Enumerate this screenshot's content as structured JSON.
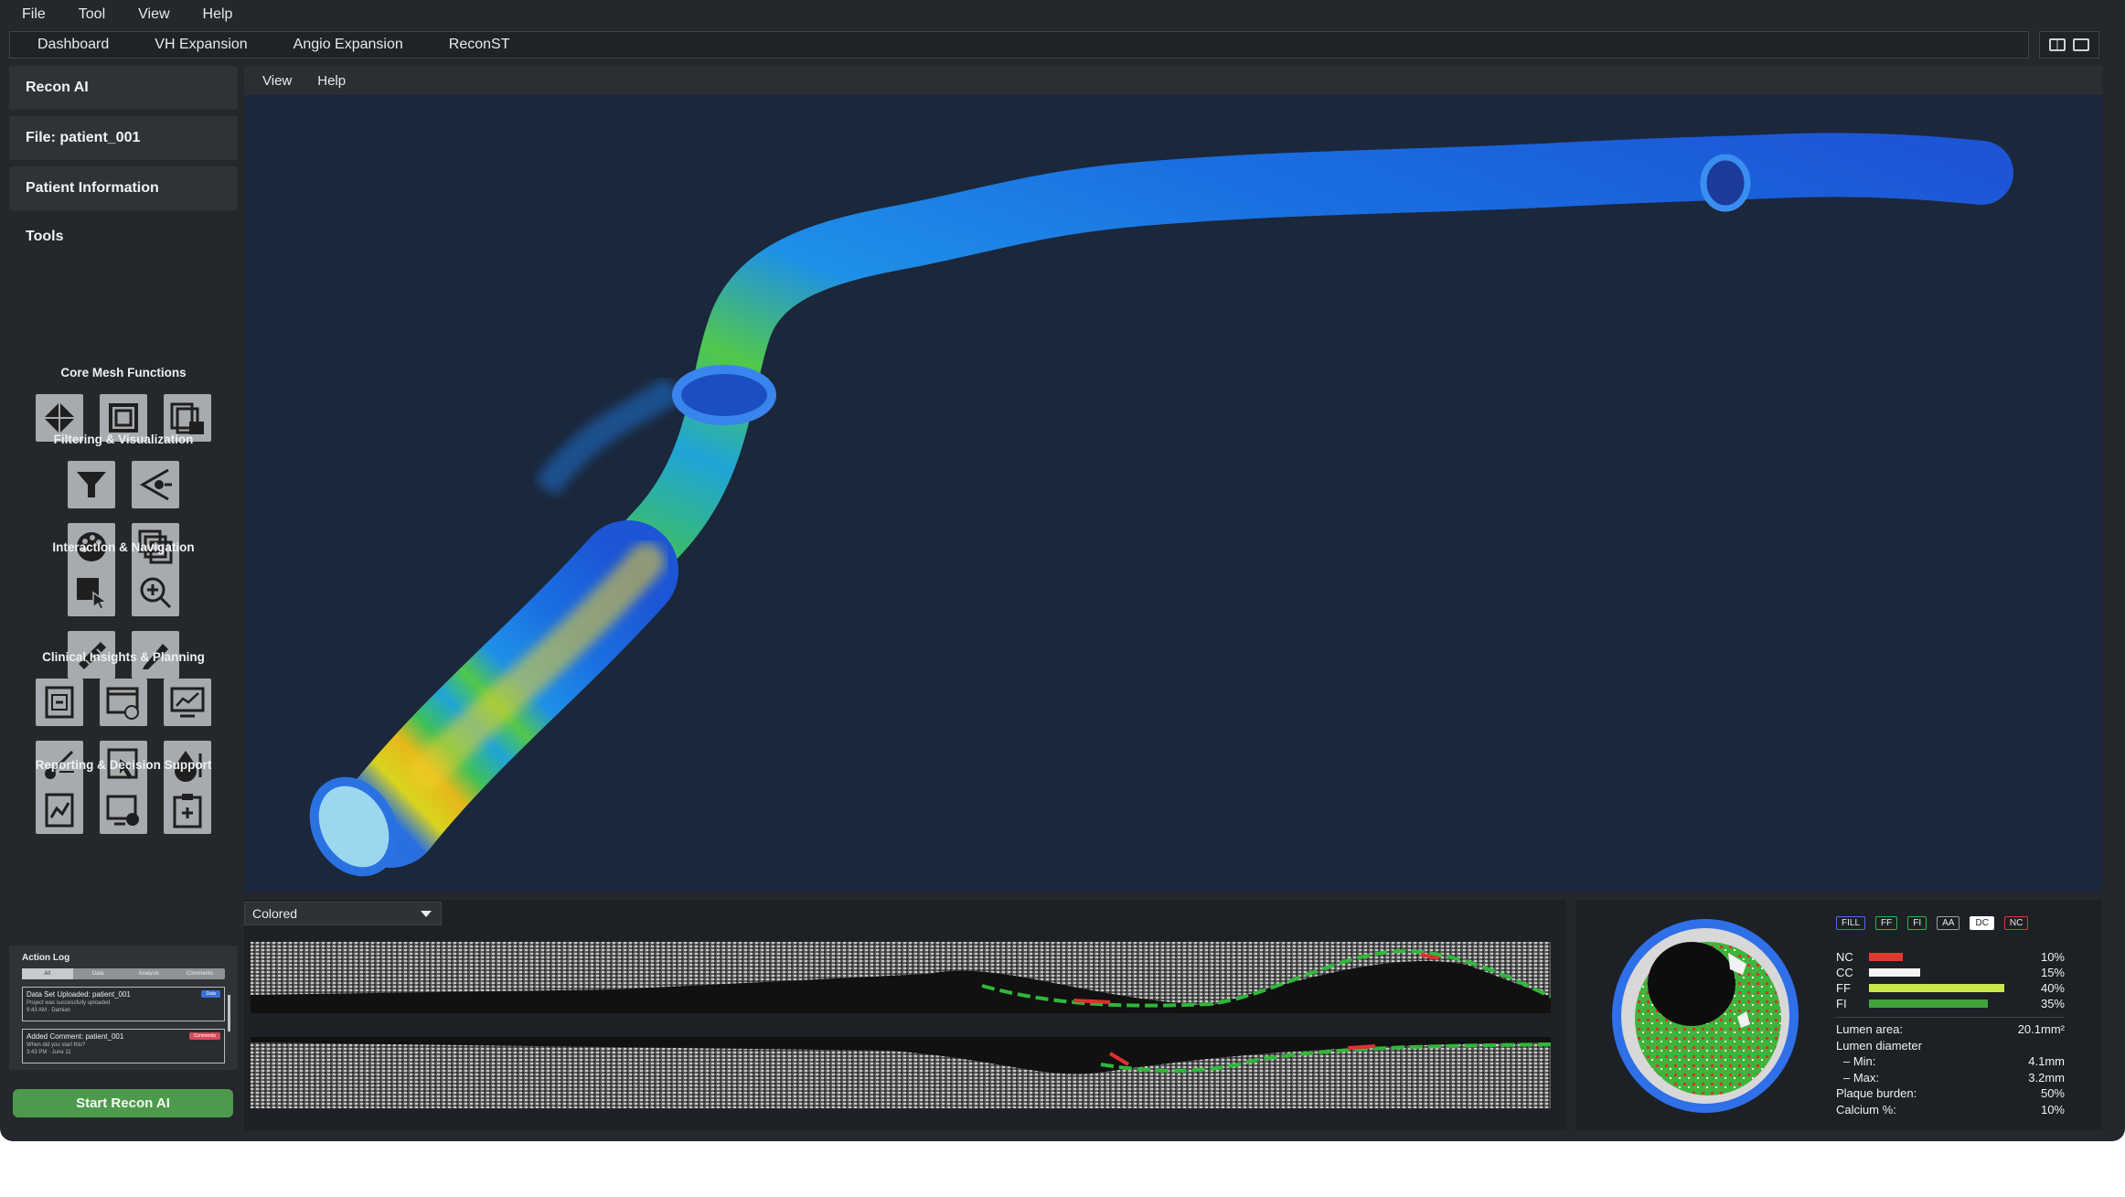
{
  "menubar": {
    "items": [
      "File",
      "Tool",
      "View",
      "Help"
    ]
  },
  "tabs": [
    "Dashboard",
    "VH Expansion",
    "Angio Expansion",
    "ReconST"
  ],
  "sidebar": {
    "cards": [
      "Recon AI",
      "File: patient_001",
      "Patient Information"
    ],
    "tools_title": "Tools",
    "sections": [
      {
        "title": "Core Mesh Functions",
        "icons": [
          "mesh-octahedron-icon",
          "frame-layers-icon",
          "save-copy-icon"
        ]
      },
      {
        "title": "Filtering & Visualization",
        "icons": [
          "filter-funnel-icon",
          "slice-view-icon",
          "color-palette-icon",
          "layers-copy-icon"
        ]
      },
      {
        "title": "Interaction & Navigation",
        "icons": [
          "select-cursor-icon",
          "zoom-in-icon",
          "ruler-icon",
          "pencil-icon"
        ]
      },
      {
        "title": "Clinical Insights & Planning",
        "icons": [
          "scan-document-icon",
          "timeline-window-icon",
          "monitor-chart-icon",
          "stent-tool-icon",
          "touch-select-icon",
          "blood-drop-icon"
        ]
      },
      {
        "title": "Reporting & Decision Support",
        "icons": [
          "report-chart-icon",
          "screen-settings-icon",
          "clipboard-medical-icon"
        ]
      }
    ],
    "action_log": {
      "title": "Action Log",
      "tabs": [
        "All",
        "Data",
        "Analysis",
        "Comments"
      ],
      "items": [
        {
          "title": "Data Set Uploaded: patient_001",
          "desc": "Project was successfully uploaded",
          "meta": "9:43 AM · Damian",
          "badge": "Data",
          "badge_color": "#3b6fd6"
        },
        {
          "title": "Added Comment: patient_001",
          "desc": "When did you start this?",
          "meta": "3:43 PM · June 11",
          "badge": "Comments",
          "badge_color": "#d64a5b"
        }
      ]
    },
    "start_button": "Start Recon AI"
  },
  "viewport": {
    "menu": [
      "View",
      "Help"
    ]
  },
  "ivus": {
    "mode": "Colored"
  },
  "cross_section": {
    "legend_buttons": [
      {
        "label": "FILL",
        "color": "#4a6fd8"
      },
      {
        "label": "FF",
        "color": "#2fb34a"
      },
      {
        "label": "FI",
        "color": "#2fb34a"
      },
      {
        "label": "AA",
        "color": "#9aa0a6"
      },
      {
        "label": "DC",
        "color": "#ffffff"
      },
      {
        "label": "NC",
        "color": "#d83a3a"
      }
    ],
    "composition": [
      {
        "name": "NC",
        "value": 10,
        "label": "10%",
        "color": "#e03a30"
      },
      {
        "name": "CC",
        "value": 15,
        "label": "15%",
        "color": "#f4f4f4"
      },
      {
        "name": "FF",
        "value": 40,
        "label": "40%",
        "color": "#c8e84a"
      },
      {
        "name": "FI",
        "value": 35,
        "label": "35%",
        "color": "#3fa53a"
      }
    ],
    "metrics": [
      {
        "label": "Lumen area:",
        "value": "20.1mm²",
        "sub": false
      },
      {
        "label": "Lumen diameter",
        "value": "",
        "sub": false
      },
      {
        "label": "–  Min:",
        "value": "4.1mm",
        "sub": true
      },
      {
        "label": "–  Max:",
        "value": "3.2mm",
        "sub": true
      },
      {
        "label": "Plaque burden:",
        "value": "50%",
        "sub": false
      },
      {
        "label": "Calcium %:",
        "value": "10%",
        "sub": false
      }
    ]
  }
}
